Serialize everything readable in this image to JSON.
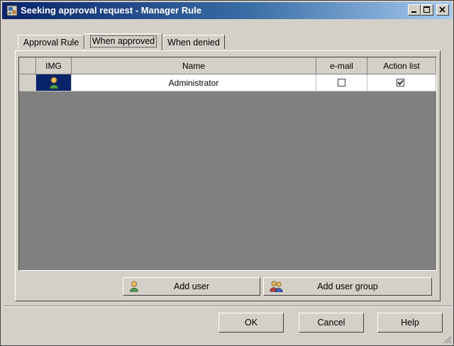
{
  "window": {
    "title": "Seeking approval request - Manager Rule"
  },
  "tabs": [
    {
      "label": "Approval Rule"
    },
    {
      "label": "When approved"
    },
    {
      "label": "When denied"
    }
  ],
  "active_tab": "When approved",
  "grid": {
    "columns": [
      "IMG",
      "Name",
      "e-mail",
      "Action list"
    ],
    "rows": [
      {
        "icon": "user-icon",
        "name": "Administrator",
        "email": false,
        "action_list": true
      }
    ]
  },
  "buttons": {
    "add_user": "Add user",
    "add_user_group": "Add user group",
    "ok": "OK",
    "cancel": "Cancel",
    "help": "Help"
  },
  "colors": {
    "title_start": "#0a246a",
    "title_end": "#a6caf0",
    "grid_bg": "#808080",
    "selection": "#0a246a",
    "face": "#d4d0c8"
  }
}
